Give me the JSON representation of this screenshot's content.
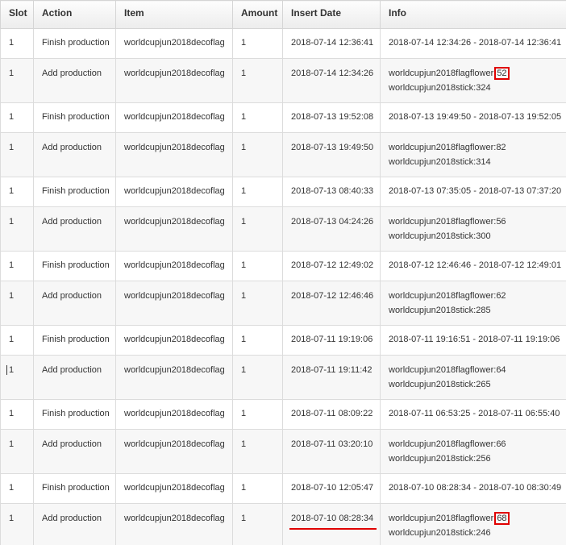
{
  "table": {
    "headers": {
      "slot": "Slot",
      "action": "Action",
      "item": "Item",
      "amount": "Amount",
      "insert_date": "Insert Date",
      "info": "Info"
    },
    "rows": [
      {
        "slot": "1",
        "action": "Finish production",
        "item": "worldcupjun2018decoflag",
        "amount": "1",
        "insert_date": "2018-07-14 12:36:41",
        "info": "2018-07-14 12:34:26 - 2018-07-14 12:36:41"
      },
      {
        "slot": "1",
        "action": "Add production",
        "item": "worldcupjun2018decoflag",
        "amount": "1",
        "insert_date": "2018-07-14 12:34:26",
        "info_flower_label": "worldcupjun2018flagflower:",
        "info_flower_value": "52",
        "info_stick": "worldcupjun2018stick:324"
      },
      {
        "slot": "1",
        "action": "Finish production",
        "item": "worldcupjun2018decoflag",
        "amount": "1",
        "insert_date": "2018-07-13 19:52:08",
        "info": "2018-07-13 19:49:50 - 2018-07-13 19:52:05"
      },
      {
        "slot": "1",
        "action": "Add production",
        "item": "worldcupjun2018decoflag",
        "amount": "1",
        "insert_date": "2018-07-13 19:49:50",
        "info_flower_label": "worldcupjun2018flagflower:",
        "info_flower_value": "82",
        "info_stick": "worldcupjun2018stick:314"
      },
      {
        "slot": "1",
        "action": "Finish production",
        "item": "worldcupjun2018decoflag",
        "amount": "1",
        "insert_date": "2018-07-13 08:40:33",
        "info": "2018-07-13 07:35:05 - 2018-07-13 07:37:20"
      },
      {
        "slot": "1",
        "action": "Add production",
        "item": "worldcupjun2018decoflag",
        "amount": "1",
        "insert_date": "2018-07-13 04:24:26",
        "info_flower_label": "worldcupjun2018flagflower:",
        "info_flower_value": "56",
        "info_stick": "worldcupjun2018stick:300"
      },
      {
        "slot": "1",
        "action": "Finish production",
        "item": "worldcupjun2018decoflag",
        "amount": "1",
        "insert_date": "2018-07-12 12:49:02",
        "info": "2018-07-12 12:46:46 - 2018-07-12 12:49:01"
      },
      {
        "slot": "1",
        "action": "Add production",
        "item": "worldcupjun2018decoflag",
        "amount": "1",
        "insert_date": "2018-07-12 12:46:46",
        "info_flower_label": "worldcupjun2018flagflower:",
        "info_flower_value": "62",
        "info_stick": "worldcupjun2018stick:285"
      },
      {
        "slot": "1",
        "action": "Finish production",
        "item": "worldcupjun2018decoflag",
        "amount": "1",
        "insert_date": "2018-07-11 19:19:06",
        "info": "2018-07-11 19:16:51 - 2018-07-11 19:19:06"
      },
      {
        "slot": "1",
        "action": "Add production",
        "item": "worldcupjun2018decoflag",
        "amount": "1",
        "insert_date": "2018-07-11 19:11:42",
        "info_flower_label": "worldcupjun2018flagflower:",
        "info_flower_value": "64",
        "info_stick": "worldcupjun2018stick:265"
      },
      {
        "slot": "1",
        "action": "Finish production",
        "item": "worldcupjun2018decoflag",
        "amount": "1",
        "insert_date": "2018-07-11 08:09:22",
        "info": "2018-07-11 06:53:25 - 2018-07-11 06:55:40"
      },
      {
        "slot": "1",
        "action": "Add production",
        "item": "worldcupjun2018decoflag",
        "amount": "1",
        "insert_date": "2018-07-11 03:20:10",
        "info_flower_label": "worldcupjun2018flagflower:",
        "info_flower_value": "66",
        "info_stick": "worldcupjun2018stick:256"
      },
      {
        "slot": "1",
        "action": "Finish production",
        "item": "worldcupjun2018decoflag",
        "amount": "1",
        "insert_date": "2018-07-10 12:05:47",
        "info": "2018-07-10 08:28:34 - 2018-07-10 08:30:49"
      },
      {
        "slot": "1",
        "action": "Add production",
        "item": "worldcupjun2018decoflag",
        "amount": "1",
        "insert_date": "2018-07-10 08:28:34",
        "info_flower_label": "worldcupjun2018flagflower:",
        "info_flower_value": "68",
        "info_stick": "worldcupjun2018stick:246"
      }
    ]
  },
  "highlight": {
    "color": "#e00000"
  }
}
